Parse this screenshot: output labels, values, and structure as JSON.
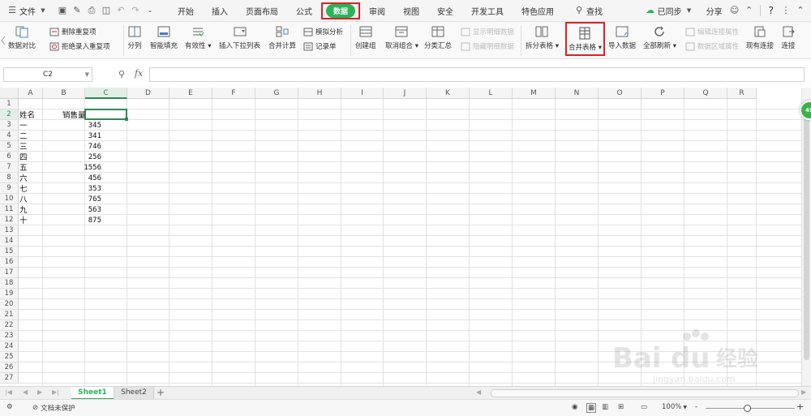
{
  "menubar": {
    "file_label": "文件",
    "tabs": [
      "开始",
      "插入",
      "页面布局",
      "公式",
      "数据",
      "审阅",
      "视图",
      "安全",
      "开发工具",
      "特色应用"
    ],
    "active_tab": "数据",
    "search_label": "查找",
    "sync_label": "已同步",
    "share_label": "分享",
    "help_label": "?"
  },
  "ribbon": {
    "data_compare": "数据对比",
    "delete_dup": "删除重复项",
    "reject_dup": "拒绝录入重复项",
    "split_col": "分列",
    "smart_fill": "智能填充",
    "validity": "有效性",
    "dropdown_list": "插入下拉列表",
    "merge_calc": "合并计算",
    "simulate": "模拟分析",
    "record_form": "记录单",
    "create_group": "创建组",
    "cancel_group": "取消组合",
    "subtotal": "分类汇总",
    "show_detail": "显示明细数据",
    "hide_detail": "隐藏明细数据",
    "split_table": "拆分表格",
    "merge_table": "合并表格",
    "import_data": "导入数据",
    "refresh_all": "全部刷新",
    "edit_conn": "编辑连接属性",
    "region_prop": "数据区域属性",
    "existing_conn": "现有连接",
    "connect": "连接"
  },
  "formula_bar": {
    "cell_ref": "C2",
    "fx_label": "fx",
    "formula": ""
  },
  "grid": {
    "columns": [
      "A",
      "B",
      "C",
      "D",
      "E",
      "F",
      "G",
      "H",
      "I",
      "J",
      "K",
      "L",
      "M",
      "N",
      "O",
      "P",
      "Q",
      "R"
    ],
    "rows": [
      "1",
      "2",
      "3",
      "4",
      "5",
      "6",
      "7",
      "8",
      "9",
      "10",
      "11",
      "12",
      "13",
      "14",
      "15",
      "16",
      "17",
      "18",
      "19",
      "20",
      "21",
      "22",
      "23",
      "24",
      "25",
      "26",
      "27"
    ],
    "selected_col": "C",
    "selected_row": "2",
    "header": {
      "a": "姓名",
      "b": "销售量"
    },
    "data": [
      {
        "name": "一",
        "sales": "345"
      },
      {
        "name": "二",
        "sales": "341"
      },
      {
        "name": "三",
        "sales": "746"
      },
      {
        "name": "四",
        "sales": "256"
      },
      {
        "name": "五",
        "sales": "1556"
      },
      {
        "name": "六",
        "sales": "456"
      },
      {
        "name": "七",
        "sales": "353"
      },
      {
        "name": "八",
        "sales": "765"
      },
      {
        "name": "九",
        "sales": "563"
      },
      {
        "name": "十",
        "sales": "875"
      }
    ]
  },
  "badge": "4S",
  "sheets": {
    "tabs": [
      "Sheet1",
      "Sheet2"
    ],
    "active": "Sheet1",
    "add": "+"
  },
  "statusbar": {
    "protect_label": "文档未保护",
    "zoom": "100%",
    "zoom_minus": "-",
    "zoom_plus": "+"
  },
  "watermark": {
    "brand": "Bai du 经验",
    "url": "jingyan.baidu.com"
  },
  "colors": {
    "accent": "#2bb358",
    "highlight": "#e02020",
    "selection": "#2e8b57"
  }
}
